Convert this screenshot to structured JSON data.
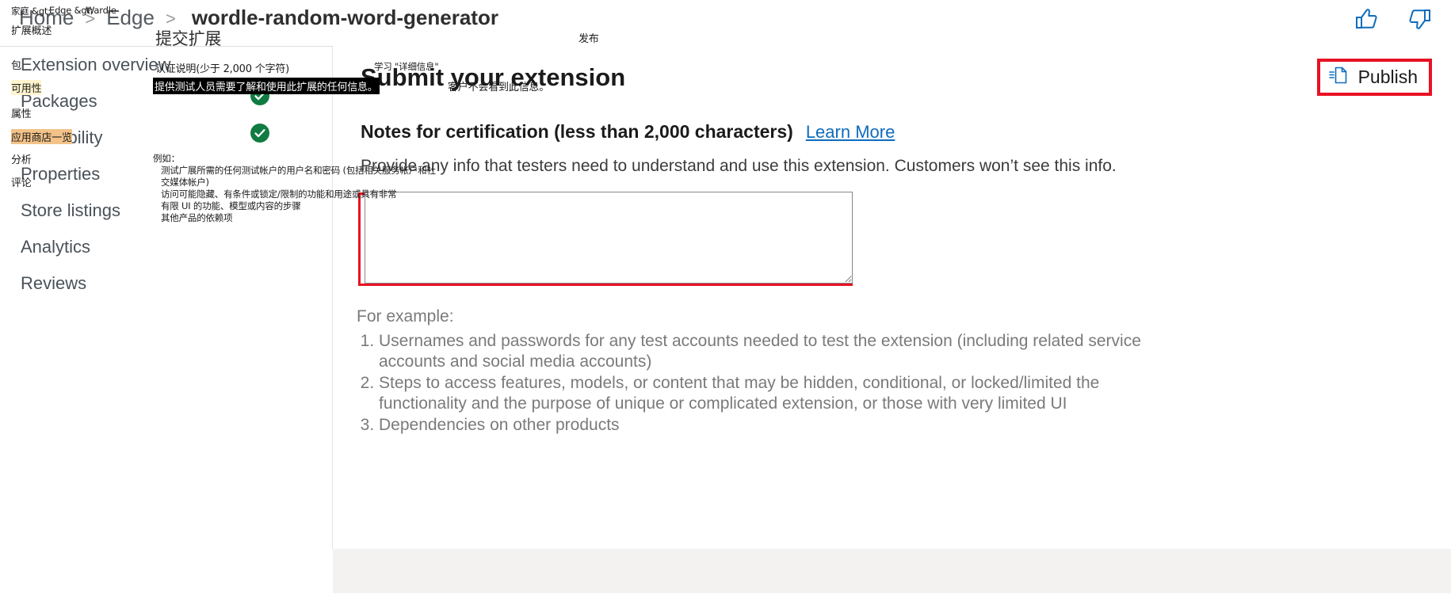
{
  "header": {
    "breadcrumb": {
      "items": [
        "Home",
        "Edge"
      ],
      "separator": ">",
      "current": "wordle-random-word-generator"
    },
    "feedback": {
      "thumbs_up_icon": "thumbs-up-icon",
      "thumbs_down_icon": "thumbs-down-icon"
    }
  },
  "sidebar": {
    "items": [
      {
        "label": "Extension overview"
      },
      {
        "label": "Packages"
      },
      {
        "label": "Availability"
      },
      {
        "label": "Properties"
      },
      {
        "label": "Store listings"
      },
      {
        "label": "Analytics"
      },
      {
        "label": "Reviews"
      }
    ]
  },
  "main": {
    "title": "Submit your extension",
    "publish_button": {
      "label": "Publish",
      "icon": "publish-document-icon"
    },
    "section": {
      "heading": "Notes for certification (less than 2,000 characters)",
      "learn_more": "Learn More",
      "description": "Provide any info that testers need to understand and use this extension. Customers won’t see this info.",
      "textarea_value": "",
      "textarea_placeholder": ""
    },
    "for_example_label": "For example:",
    "examples": [
      "Usernames and passwords for any test accounts needed to test the extension (including related service accounts and social media accounts)",
      "Steps to access features, models, or content that may be hidden, conditional, or locked/limited the functionality and the purpose of unique or complicated extension, or those with very limited UI",
      "Dependencies on other products"
    ]
  },
  "overlay_translation": {
    "breadcrumb_home": "家庭 &gt;",
    "breadcrumb_edge": "Edge &gt;",
    "breadcrumb_current": "Wardle",
    "nav_extension_overview": "扩展概述",
    "nav_packages": "包",
    "nav_availability": "可用性",
    "nav_properties": "属性",
    "nav_store_listings": "应用商店一览",
    "nav_analytics": "分析",
    "nav_reviews": "评论",
    "page_title": "提交扩展",
    "section_heading": "认证说明(少于 2,000 个字符)",
    "section_desc_part1": "提供测试人员需要了解和使用此扩展的任何信息。",
    "section_desc_part2": "客户不会看到此信息。",
    "learn_more": "学习 \"详细信息\"",
    "publish": "发布",
    "for_example_label": "例如：",
    "example_line1": "测试广展所需的任何测试帐户的用户名和密码 (包括相关服务帐户和社",
    "example_line2": "交媒体帐户)",
    "example_line3": "访问可能隐藏、有条件或锁定/限制的功能和用途或具有非常",
    "example_line4": "有限 UI 的功能、模型或内容的步骤",
    "example_line5": "其他产品的依赖项"
  },
  "colors": {
    "accent_link": "#0f6cbd",
    "highlight_red": "#e81123",
    "success_green": "#107c41",
    "highlight_yellow": "#fff4ce",
    "highlight_orange": "#f2c288"
  }
}
